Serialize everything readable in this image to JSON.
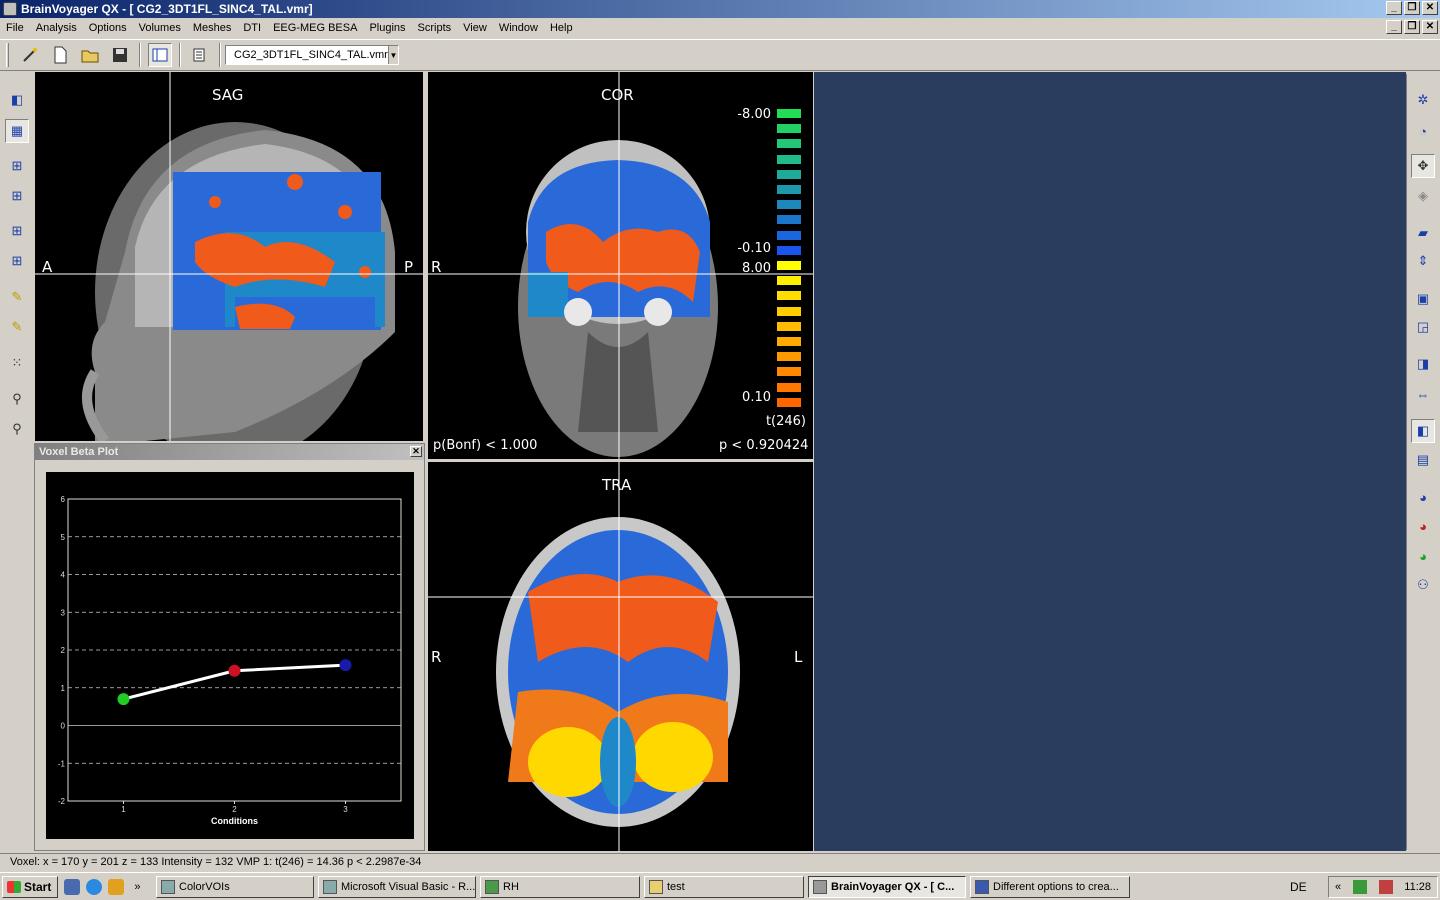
{
  "window": {
    "title": "BrainVoyager QX - [ CG2_3DT1FL_SINC4_TAL.vmr]",
    "buttons": [
      "_",
      "❐",
      "✕"
    ]
  },
  "menu": [
    "File",
    "Analysis",
    "Options",
    "Volumes",
    "Meshes",
    "DTI",
    "EEG-MEG BESA",
    "Plugins",
    "Scripts",
    "View",
    "Window",
    "Help"
  ],
  "toolbar": {
    "file_combo_value": "CG2_3DT1FL_SINC4_TAL.vmr",
    "icons": [
      "wand-icon",
      "new-file-icon",
      "open-folder-icon",
      "save-icon",
      "layout-icon",
      "list-icon"
    ]
  },
  "views": {
    "sag": {
      "label": "SAG",
      "left": "A",
      "right": "P"
    },
    "cor": {
      "label": "COR",
      "left": "R",
      "pbonf": "p(Bonf) < 1.000",
      "p": "p < 0.920424"
    },
    "tra": {
      "label": "TRA",
      "left": "R",
      "right": "L"
    }
  },
  "colorbar": {
    "neg_max": "-8.00",
    "neg_min": "-0.10",
    "pos_max": "8.00",
    "pos_min": "0.10",
    "stat": "t(246)",
    "neg_colors": [
      "#22dd55",
      "#22d066",
      "#22c877",
      "#20bb88",
      "#1faa99",
      "#1e99aa",
      "#1d88bb",
      "#1c77cc",
      "#1b66dd",
      "#1a55ee"
    ],
    "pos_colors": [
      "#ffff00",
      "#ffee00",
      "#ffdd00",
      "#ffcc00",
      "#ffbb00",
      "#ffaa00",
      "#ff9900",
      "#ff8800",
      "#ff7700",
      "#ff6600"
    ]
  },
  "beta_plot": {
    "title": "Voxel Beta Plot",
    "xlabel": "Conditions"
  },
  "chart_data": {
    "type": "line",
    "title": "Voxel Beta Plot",
    "xlabel": "Conditions",
    "ylabel": "",
    "categories": [
      "1",
      "2",
      "3"
    ],
    "x": [
      1,
      2,
      3
    ],
    "values": [
      0.7,
      1.45,
      1.6
    ],
    "point_colors": [
      "#22cc22",
      "#cc1122",
      "#1a1aaa"
    ],
    "ylim": [
      -2,
      6
    ],
    "xlim": [
      0.5,
      3.5
    ],
    "yticks": [
      "6",
      "5",
      "4",
      "3",
      "2",
      "1",
      "0",
      "-1",
      "-2"
    ],
    "grid": true
  },
  "status": "Voxel:  x = 170 y = 201 z = 133  Intensity = 132   VMP 1:  t(246) = 14.36  p < 2.2987e-34",
  "taskbar": {
    "start": "Start",
    "tasks": [
      "ColorVOIs",
      "Microsoft Visual Basic - R...",
      "RH",
      "test",
      "BrainVoyager QX - [ C...",
      "Different options to crea..."
    ],
    "lang": "DE",
    "tray_arrows": "«",
    "clock": "11:28"
  }
}
